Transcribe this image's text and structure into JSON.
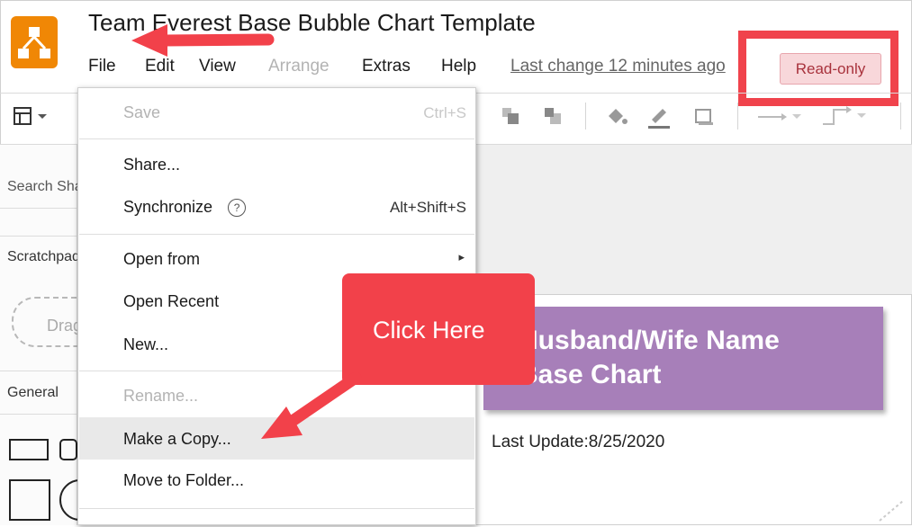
{
  "header": {
    "title": "Team Everest Base Bubble Chart Template",
    "menus": [
      "File",
      "Edit",
      "View",
      "Arrange",
      "Extras",
      "Help"
    ],
    "last_change": "Last change 12 minutes ago",
    "status_badge": "Read-only"
  },
  "sidebar": {
    "search_placeholder": "Search Shapes",
    "scratchpad": "Scratchpad",
    "draw_hint": "Drag elements here",
    "general": "General"
  },
  "file_menu": {
    "save": "Save",
    "save_shortcut": "Ctrl+S",
    "share": "Share...",
    "synchronize": "Synchronize",
    "help_glyph": "?",
    "synchronize_shortcut": "Alt+Shift+S",
    "open_from": "Open from",
    "submenu_arrow": "▸",
    "open_recent": "Open Recent",
    "new": "New...",
    "rename": "Rename...",
    "make_copy": "Make a Copy...",
    "move_to_folder": "Move to Folder..."
  },
  "canvas": {
    "box_line1": "Husband/Wife Name",
    "box_line2": "Base Chart",
    "last_update": "Last Update:8/25/2020",
    "box_color": "#a77fb9"
  },
  "callout": {
    "text": "Click Here",
    "color": "#f2414a"
  },
  "colors": {
    "logo": "#f08705",
    "highlight": "#f0434c",
    "badge_bg": "#f8d7da"
  }
}
